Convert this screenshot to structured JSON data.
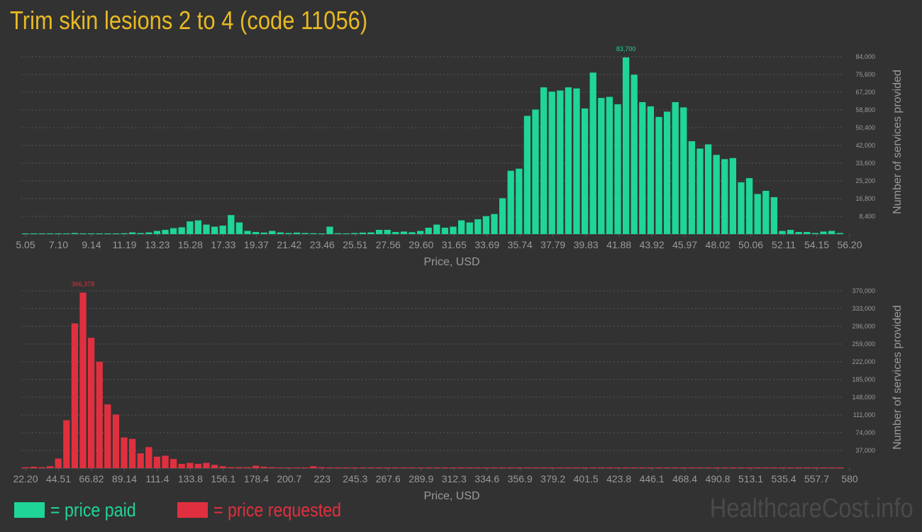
{
  "title": "Trim skin lesions 2 to 4 (code 11056)",
  "colors": {
    "paid": "#1fd598",
    "requested": "#e0303f",
    "title": "#e8b923",
    "axis_text": "#9a9a9a",
    "grid": "#555555"
  },
  "chart_data": [
    {
      "type": "bar",
      "series_key": "paid",
      "xlabel": "Price, USD",
      "ylabel": "Number of services provided",
      "ylim": [
        0,
        84000
      ],
      "yticks": [
        "8,400",
        "16,800",
        "25,200",
        "33,600",
        "42,000",
        "50,400",
        "58,800",
        "67,200",
        "75,600",
        "84,000"
      ],
      "xticks": [
        "5.05",
        "7.10",
        "9.14",
        "11.19",
        "13.23",
        "15.28",
        "17.33",
        "19.37",
        "21.42",
        "23.46",
        "25.51",
        "27.56",
        "29.60",
        "31.65",
        "33.69",
        "35.74",
        "37.79",
        "39.83",
        "41.88",
        "43.92",
        "45.97",
        "48.02",
        "50.06",
        "52.11",
        "54.15",
        "56.20"
      ],
      "peak_label": "83,700",
      "values": [
        300,
        100,
        100,
        200,
        100,
        300,
        500,
        200,
        300,
        100,
        200,
        300,
        400,
        800,
        500,
        800,
        1500,
        2000,
        2800,
        3200,
        6000,
        6500,
        4500,
        3500,
        4000,
        9000,
        5500,
        1500,
        1000,
        700,
        1500,
        800,
        500,
        700,
        500,
        400,
        300,
        3500,
        400,
        300,
        500,
        700,
        800,
        2000,
        2000,
        1000,
        1200,
        900,
        1500,
        3000,
        4500,
        3000,
        3500,
        6500,
        5500,
        7000,
        8500,
        9500,
        17000,
        30000,
        31000,
        56000,
        59000,
        69500,
        67500,
        68000,
        69500,
        69000,
        59500,
        76500,
        64500,
        65000,
        61500,
        83700,
        75500,
        62500,
        60500,
        55500,
        58000,
        62500,
        60000,
        44000,
        40500,
        42500,
        37500,
        35500,
        36000,
        24500,
        26500,
        19000,
        20500,
        17500,
        1500,
        2000,
        1000,
        1000,
        500,
        1200,
        1500,
        500
      ]
    },
    {
      "type": "bar",
      "series_key": "requested",
      "xlabel": "Price, USD",
      "ylabel": "Number of services provided",
      "ylim": [
        0,
        370000
      ],
      "yticks": [
        "37,000",
        "74,000",
        "111,000",
        "148,000",
        "185,000",
        "222,000",
        "259,000",
        "296,000",
        "333,000",
        "370,000"
      ],
      "xticks": [
        "22.20",
        "44.51",
        "66.82",
        "89.14",
        "111.4",
        "133.8",
        "156.1",
        "178.4",
        "200.7",
        "223",
        "245.3",
        "267.6",
        "289.9",
        "312.3",
        "334.6",
        "356.9",
        "379.2",
        "401.5",
        "423.8",
        "446.1",
        "468.4",
        "490.8",
        "513.1",
        "535.4",
        "557.7",
        "580"
      ],
      "peak_label": "366,378",
      "values": [
        2000,
        3000,
        2000,
        4000,
        20000,
        100000,
        302000,
        366378,
        272000,
        222000,
        133000,
        112000,
        64000,
        61000,
        31000,
        44000,
        24000,
        26000,
        19000,
        9000,
        11000,
        9000,
        11000,
        7000,
        4000,
        2000,
        2000,
        2000,
        5000,
        3000,
        2000,
        1000,
        1000,
        1000,
        1000,
        4000,
        2000,
        1000,
        1000,
        1000,
        1000,
        500,
        500,
        500,
        500,
        500,
        500,
        500,
        500,
        500,
        500,
        500,
        1000,
        500,
        500,
        500,
        500,
        500,
        500,
        500,
        500,
        500,
        500,
        500,
        500,
        500,
        500,
        1000,
        500,
        500,
        500,
        500,
        500,
        500,
        500,
        500,
        500,
        500,
        500,
        1000,
        500,
        500,
        500,
        500,
        500,
        500,
        500,
        500,
        500,
        500,
        500,
        500,
        1000,
        500,
        500,
        500,
        500,
        500,
        500,
        1000
      ]
    }
  ],
  "legend": [
    {
      "key": "paid",
      "label": "= price paid"
    },
    {
      "key": "requested",
      "label": "= price requested"
    }
  ],
  "watermark": "HealthcareCost.info"
}
